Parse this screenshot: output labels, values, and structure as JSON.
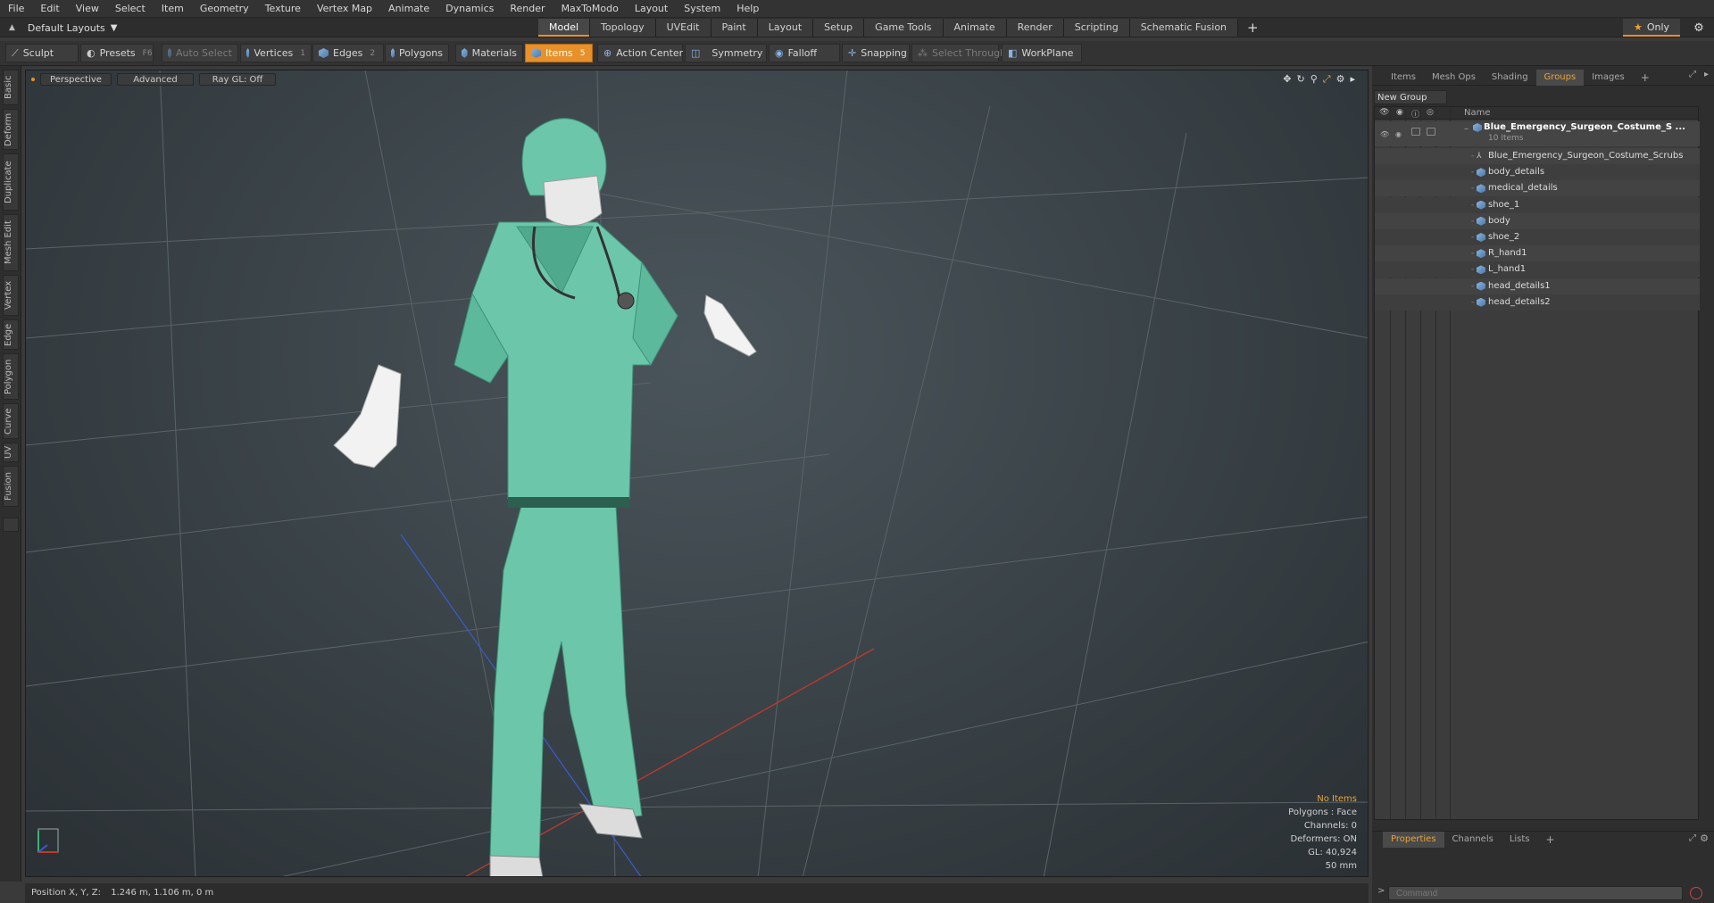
{
  "menu": [
    "File",
    "Edit",
    "View",
    "Select",
    "Item",
    "Geometry",
    "Texture",
    "Vertex Map",
    "Animate",
    "Dynamics",
    "Render",
    "MaxToModo",
    "Layout",
    "System",
    "Help"
  ],
  "layout_selector": "Default Layouts",
  "layout_tabs": [
    "Model",
    "Topology",
    "UVEdit",
    "Paint",
    "Layout",
    "Setup",
    "Game Tools",
    "Animate",
    "Render",
    "Scripting",
    "Schematic Fusion"
  ],
  "only_label": "Only",
  "toolbar": {
    "sculpt": "Sculpt",
    "presets": "Presets",
    "presets_key": "F6",
    "auto_select": "Auto Select",
    "vertices": "Vertices",
    "vertices_num": "1",
    "edges": "Edges",
    "edges_num": "2",
    "polygons": "Polygons",
    "materials": "Materials",
    "items": "Items",
    "items_num": "5",
    "action_center": "Action Center",
    "symmetry": "Symmetry",
    "falloff": "Falloff",
    "snapping": "Snapping",
    "select_through": "Select Through",
    "workplane": "WorkPlane"
  },
  "left_tabs": [
    "Basic",
    "Deform",
    "Duplicate",
    "Mesh Edit",
    "Vertex",
    "Edge",
    "Polygon",
    "Curve",
    "UV",
    "Fusion"
  ],
  "viewport": {
    "view_mode": "Perspective",
    "advanced": "Advanced",
    "raygl": "Ray GL: Off",
    "info": {
      "no_items": "No Items",
      "polygons": "Polygons : Face",
      "channels": "Channels: 0",
      "deformers": "Deformers: ON",
      "gl": "GL: 40,924",
      "lens": "50 mm"
    },
    "colors": {
      "scrubs": "#6cc7aa",
      "scrubs_shade": "#3f8f77",
      "gloves": "#f2f2f2",
      "grid": "#5a6468",
      "axis_x": "#c0392b",
      "axis_z": "#3a5bd0"
    }
  },
  "right_panel": {
    "tabs": [
      "Items",
      "Mesh Ops",
      "Shading",
      "Groups",
      "Images"
    ],
    "active_tab": "Groups",
    "new_group": "New Group",
    "name_header": "Name",
    "group_name": "Blue_Emergency_Surgeon_Costume_S ...",
    "group_count": "10 Items",
    "items": [
      "Blue_Emergency_Surgeon_Costume_Scrubs",
      "body_details",
      "medical_details",
      "shoe_1",
      "body",
      "shoe_2",
      "R_hand1",
      "L_hand1",
      "head_details1",
      "head_details2"
    ],
    "bottom_tabs": [
      "Properties",
      "Channels",
      "Lists"
    ],
    "active_bottom_tab": "Properties",
    "command_placeholder": "Command"
  },
  "status": {
    "position_label": "Position X, Y, Z:",
    "position_value": "1.246 m, 1.106 m, 0 m"
  }
}
